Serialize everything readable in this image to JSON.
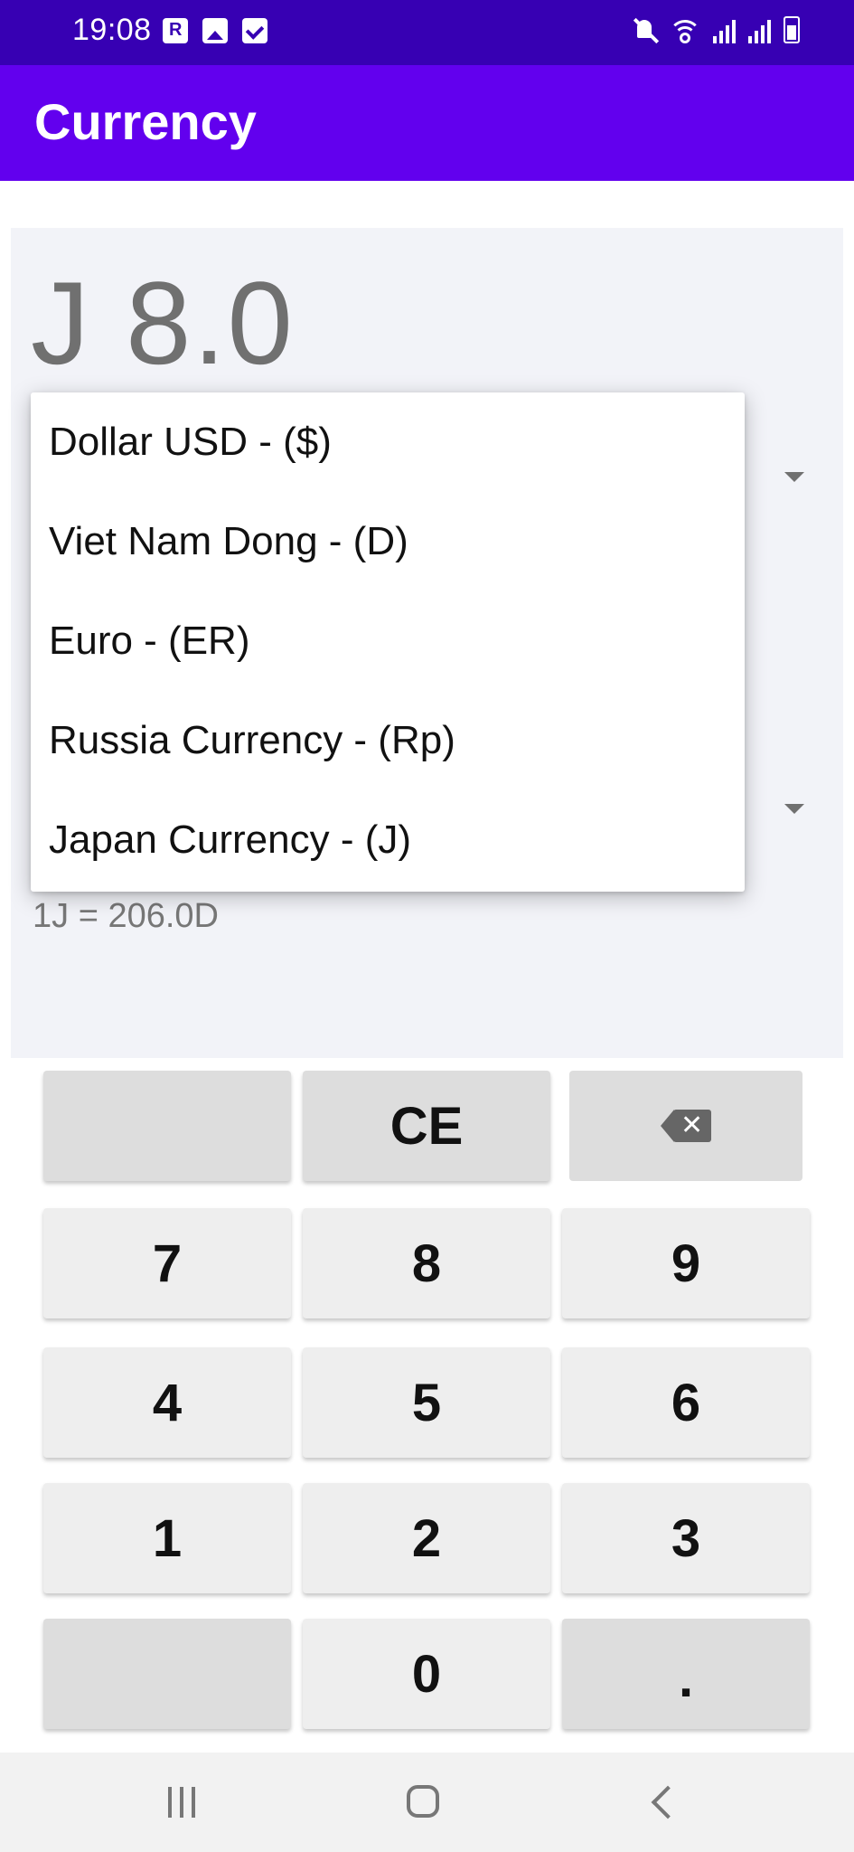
{
  "status_bar": {
    "time": "19:08",
    "left_icons": [
      "r-app-icon",
      "image-icon",
      "check-icon"
    ],
    "right_icons": [
      "mute-icon",
      "wifi-icon",
      "signal-icon",
      "signal-icon",
      "battery-charging-icon"
    ]
  },
  "app_bar": {
    "title": "Currency"
  },
  "converter": {
    "amount": "J 8.0",
    "rate_text": "1J = 206.0D"
  },
  "dropdown": {
    "options": [
      "Dollar USD - ($)",
      "Viet Nam Dong - (D)",
      "Euro - (ER)",
      "Russia Currency - (Rp)",
      "Japan Currency - (J)"
    ]
  },
  "keypad": {
    "rows": [
      [
        "",
        "CE",
        "backspace-icon"
      ],
      [
        "7",
        "8",
        "9"
      ],
      [
        "4",
        "5",
        "6"
      ],
      [
        "1",
        "2",
        "3"
      ],
      [
        "",
        "0",
        "."
      ]
    ]
  },
  "nav_bar": {
    "buttons": [
      "recents-icon",
      "home-icon",
      "back-icon"
    ]
  }
}
